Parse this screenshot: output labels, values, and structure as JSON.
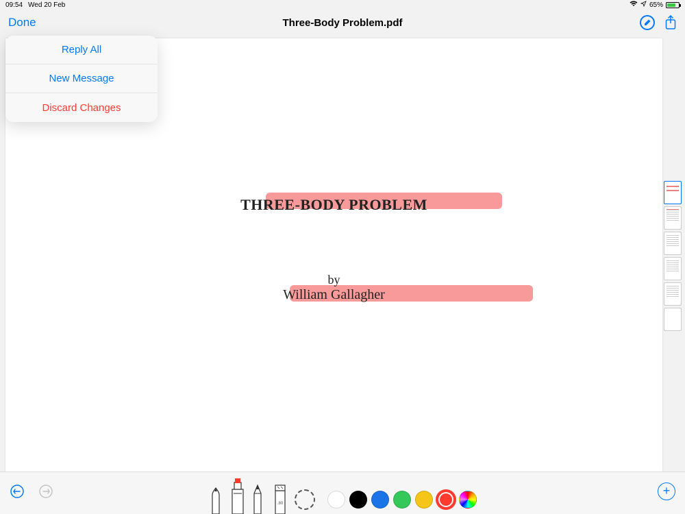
{
  "status": {
    "time": "09:54",
    "date": "Wed 20 Feb",
    "battery_pct": "65%"
  },
  "nav": {
    "done_label": "Done",
    "title": "Three-Body Problem.pdf"
  },
  "popover": {
    "items": [
      {
        "label": "Reply All",
        "style": "blue"
      },
      {
        "label": "New Message",
        "style": "blue"
      },
      {
        "label": "Discard Changes",
        "style": "red"
      }
    ]
  },
  "document": {
    "title": "THREE-BODY PROBLEM",
    "by_label": "by",
    "author": "William Gallagher"
  },
  "toolbar": {
    "ruler_label": ".80",
    "colors": {
      "white": "#ffffff",
      "black": "#000000",
      "blue": "#1b73e8",
      "green": "#34c759",
      "yellow": "#f5c518",
      "red": "#ff3b30"
    },
    "selected_color": "red"
  }
}
